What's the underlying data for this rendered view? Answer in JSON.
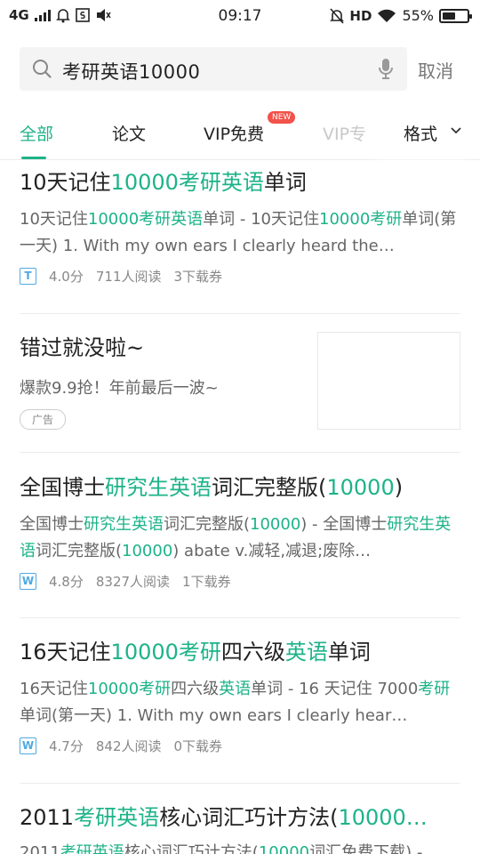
{
  "status_bar": {
    "network": "4G",
    "time": "09:17",
    "hd": "HD",
    "battery_percent": "55%",
    "battery_level": 0.55
  },
  "search": {
    "query": "考研英语10000",
    "cancel_label": "取消"
  },
  "tabs": {
    "all": "全部",
    "papers": "论文",
    "vip_free": "VIP免费",
    "new_badge": "NEW",
    "vip_partial": "VIP专",
    "format": "格式"
  },
  "results": [
    {
      "title": [
        "10天记住",
        "10000考研英语",
        "单词"
      ],
      "snippet_l1": [
        "10天记住",
        "10000考研英语",
        "单词 - 10天记住",
        "10000考研",
        "单"
      ],
      "snippet_l2": "词(第一天) 1. With my own ears I clearly heard the…",
      "type": "T",
      "score": "4.0分",
      "reads": "711人阅读",
      "downloads": "3下载券"
    },
    {
      "title": [
        "全国博士",
        "研究生英语",
        "词汇完整版(",
        "10000",
        ")"
      ],
      "snippet_l1": [
        "全国博士",
        "研究生英语",
        "词汇完整版(",
        "10000",
        ") - 全国博士",
        "研"
      ],
      "snippet_l2": [
        "究生英语",
        "词汇完整版(",
        "10000",
        ") abate v.减轻,减退;废除…"
      ],
      "type": "W",
      "score": "4.8分",
      "reads": "8327人阅读",
      "downloads": "1下载券"
    },
    {
      "title": [
        "16天记住",
        "10000考研",
        "四六级",
        "英语",
        "单词"
      ],
      "snippet_l1": [
        "16天记住",
        "10000考研",
        "四六级",
        "英语",
        "单词 - 16 天记住 7000"
      ],
      "snippet_l2": [
        "考研",
        "单词(第一天) 1. With my own ears I clearly hear…"
      ],
      "type": "W",
      "score": "4.7分",
      "reads": "842人阅读",
      "downloads": "0下载券"
    },
    {
      "title": [
        "2011",
        "考研英语",
        "核心词汇巧计方法(",
        "10000…"
      ],
      "snippet_l1": [
        "2011",
        "考研英语",
        "核心词汇巧计方法(",
        "10000",
        "词汇免费下载) -"
      ]
    }
  ],
  "ad": {
    "title": "错过就没啦~",
    "text": "爆款9.9抢！年前最后一波~",
    "badge": "广告"
  },
  "colors": {
    "accent": "#1db388",
    "new_badge": "#f2524a",
    "doc_icon": "#4fa9e0"
  }
}
